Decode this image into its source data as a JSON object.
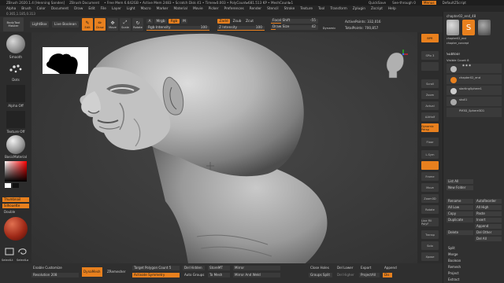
{
  "titlebar": {
    "app": "ZBrush 2020.1.4 [Henning Sanden]",
    "doc": "ZBrush Document",
    "stats": "• Free Mem 6.642GB • Active Mem 2483 • Scratch Disk 41 • Timer▸0.003 • PolyCount▸681.513 KP • MeshCount▸1",
    "quicksave": "QuickSave",
    "seethrough": "See-through  0",
    "menus": "Menus",
    "script": "DefaultZScript"
  },
  "menubar": [
    "Alpha",
    "Brush",
    "Color",
    "Document",
    "Draw",
    "Edit",
    "File",
    "Layer",
    "Light",
    "Macro",
    "Marker",
    "Material",
    "Movie",
    "Picker",
    "Preferences",
    "Render",
    "Stencil",
    "Stroke",
    "Texture",
    "Tool",
    "Transform",
    "Zplugin",
    "Zscript",
    "Help"
  ],
  "subbar": "0.365,1.185,0.313",
  "toolbar": {
    "brush_label": "BodyTool Master",
    "lightbox": "LightBox",
    "live_boolean": "Live Boolean",
    "edit": "Edit",
    "draw": "Draw",
    "move": "Move",
    "scale": "Scale",
    "rotate": "Rotate",
    "a_label": "A",
    "mrgb": "Mrgb",
    "rgb": "Rgb",
    "m": "M",
    "zadd": "Zadd",
    "zsub": "Zsub",
    "zcut": "Zcut",
    "rgb_intensity_label": "Rgb Intensity",
    "rgb_intensity_val": "100",
    "z_intensity_label": "Z Intensity",
    "z_intensity_val": "100",
    "focal_label": "Focal Shift",
    "focal_val": "-55",
    "draw_size_label": "Draw Size",
    "draw_size_val": "42",
    "dynamic": "Dynamic",
    "active_points": "ActivePoints: 332,016",
    "total_points": "TotalPoints: 700,857"
  },
  "leftshelf": {
    "smooth": "Smooth",
    "dots": "Dots",
    "alpha_off": "Alpha Off",
    "texture_off": "Texture Off",
    "basic_material": "BasicMaterial",
    "thumbnail": "Thumbnail",
    "silhouette": "Silhouette",
    "double": "Double",
    "selectlt": "SelectLt",
    "selectlo": "SelectLo"
  },
  "rightshelf": {
    "buttons": [
      "BPR",
      "SPix 3",
      "",
      "Scroll",
      "Zoom",
      "Actual",
      "AAHalf",
      "Dynamic Persp",
      "Floor",
      "L.Sym",
      "",
      "Frame",
      "Move",
      "Zoom3D",
      "Rotate",
      "Line Fill PolyF",
      "Transp",
      "Solo",
      "Xpose"
    ],
    "active": [
      0,
      7,
      10
    ]
  },
  "rightpanel": {
    "header": "chapter02_end_48",
    "tools": [
      "chapter02_end",
      "Simple8",
      "PolyMes",
      "chapter_concept"
    ],
    "subtool_title": "Subtool",
    "visible_count": "Visible Count 8",
    "subtools": [
      "chapter02_end",
      "starting5phere1",
      "skull1",
      "PM3D_Sphere3D1"
    ],
    "list_all": "List All",
    "new_folder": "New Folder",
    "ops": [
      [
        "Rename",
        "AutoReorder"
      ],
      [
        "All Low",
        "All High"
      ],
      [
        "Copy",
        "Paste"
      ],
      [
        "Duplicate",
        "Insert"
      ],
      [
        "Append",
        ""
      ],
      [
        "Delete",
        "Del Other"
      ],
      [
        "",
        "Del All"
      ]
    ],
    "split": "Split",
    "merge": "Merge",
    "boolean": "Boolean",
    "remesh": "Remesh",
    "project": "Project",
    "extract": "Extract"
  },
  "bottombar": {
    "enable_customize": "Enable Customize",
    "resolution": "Resolution 208",
    "dynamesh": "DynaMesh",
    "zremesher": "ZRemesher",
    "target_poly": "Target Polygon Count 5",
    "activate_symmetry": "Activate Symmetry",
    "del_hidden": "Del Hidden",
    "auto_groups": "Auto Groups",
    "store_mt": "StoreMT",
    "to_mesh": "To Mesh",
    "mirror": "Mirror",
    "mirror_and_weld": "Mirror And Weld",
    "close_holes": "Close Holes",
    "groups_split": "Groups Split",
    "del_lower": "Del Lower",
    "del_higher": "Del Higher",
    "export": "Export",
    "project_all": "ProjectAll",
    "append": "Append",
    "dist": "Dis"
  },
  "colors": {
    "accent": "#e8801e",
    "bg": "#2a2a2a",
    "panel": "#303030",
    "mesh": "#bdbdbd"
  }
}
